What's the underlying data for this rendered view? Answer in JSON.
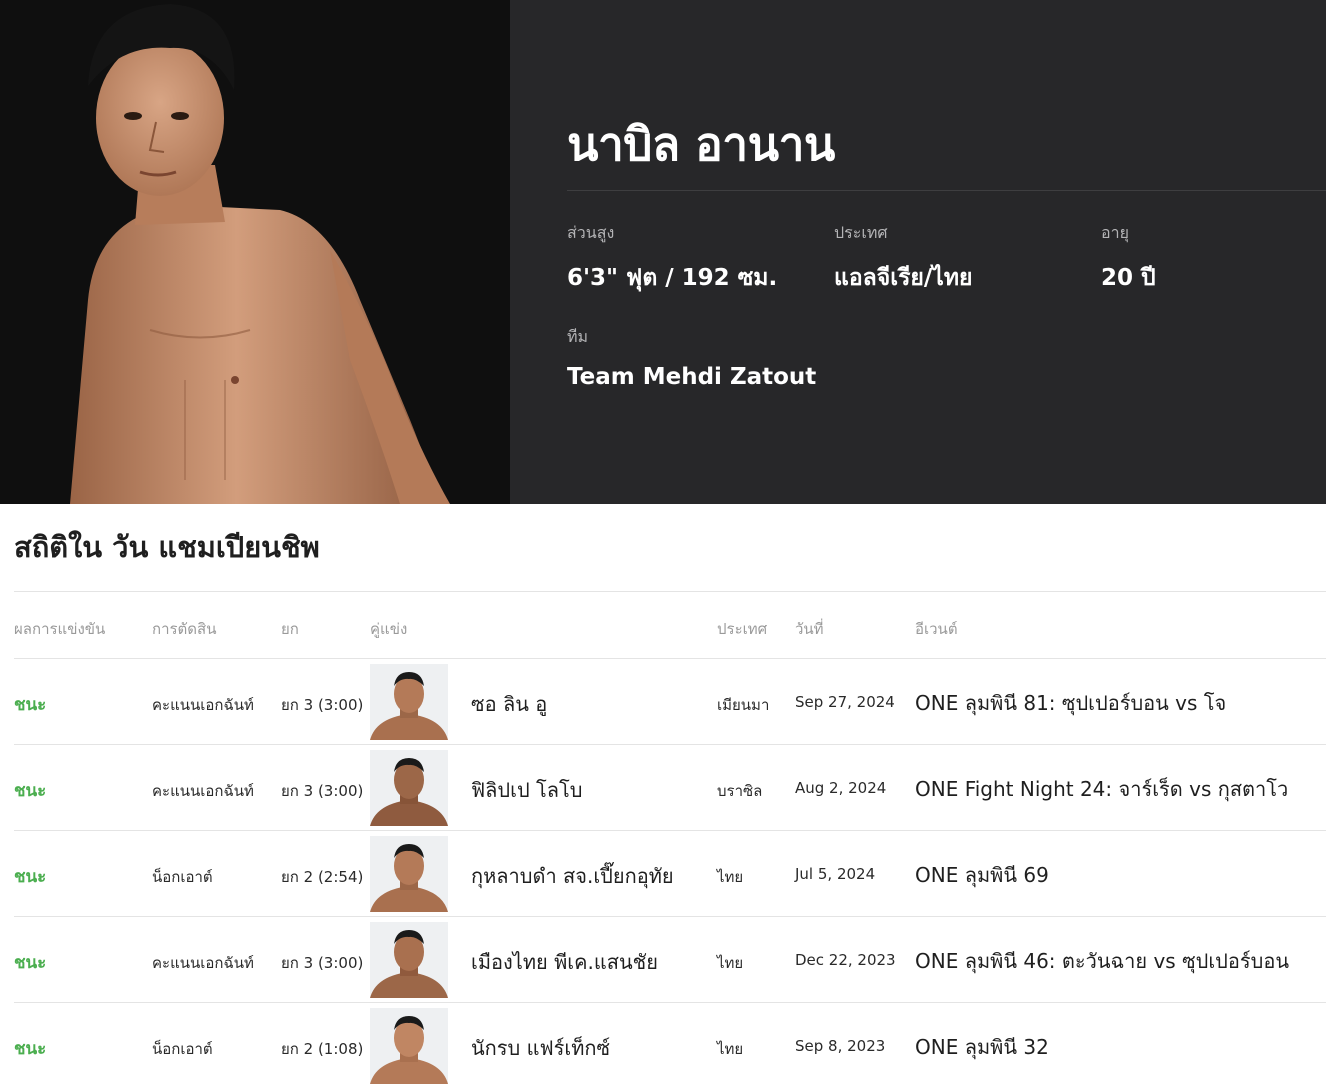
{
  "fighter": {
    "name": "นาบิล อานาน",
    "height_label": "ส่วนสูง",
    "height_value": "6'3\" ฟุต / 192 ซม.",
    "country_label": "ประเทศ",
    "country_value": "แอลจีเรีย/ไทย",
    "age_label": "อายุ",
    "age_value": "20 ปี",
    "team_label": "ทีม",
    "team_value": "Team Mehdi Zatout"
  },
  "stats": {
    "title": "สถิติใน วัน แชมเปียนชิพ",
    "headers": {
      "result": "ผลการแข่งขัน",
      "method": "การตัดสิน",
      "round": "ยก",
      "opponent": "คู่แข่ง",
      "country": "ประเทศ",
      "date": "วันที่",
      "event": "อีเวนต์"
    },
    "rows": [
      {
        "result": "ชนะ",
        "method": "คะแนนเอกฉันท์",
        "round": "ยก 3 (3:00)",
        "opponent": "ซอ ลิน อู",
        "country": "เมียนมา",
        "date": "Sep 27, 2024",
        "event": "ONE ลุมพินี 81: ซุปเปอร์บอน vs โจ"
      },
      {
        "result": "ชนะ",
        "method": "คะแนนเอกฉันท์",
        "round": "ยก 3 (3:00)",
        "opponent": "ฟิลิปเป โลโบ",
        "country": "บราซิล",
        "date": "Aug 2, 2024",
        "event": "ONE Fight Night 24: จาร์เร็ด vs กุสตาโว"
      },
      {
        "result": "ชนะ",
        "method": "น็อกเอาต์",
        "round": "ยก 2 (2:54)",
        "opponent": "กุหลาบดำ สจ.เปี๊ยกอุทัย",
        "country": "ไทย",
        "date": "Jul 5, 2024",
        "event": "ONE ลุมพินี 69"
      },
      {
        "result": "ชนะ",
        "method": "คะแนนเอกฉันท์",
        "round": "ยก 3 (3:00)",
        "opponent": "เมืองไทย พีเค.แสนชัย",
        "country": "ไทย",
        "date": "Dec 22, 2023",
        "event": "ONE ลุมพินี 46: ตะวันฉาย vs ซุปเปอร์บอน"
      },
      {
        "result": "ชนะ",
        "method": "น็อกเอาต์",
        "round": "ยก 2 (1:08)",
        "opponent": "นักรบ แฟร์เท็กซ์",
        "country": "ไทย",
        "date": "Sep 8, 2023",
        "event": "ONE ลุมพินี 32"
      }
    ]
  },
  "colors": {
    "hero_bg": "#272729",
    "photo_bg": "#0f0f0f",
    "win_green": "#4bae4f",
    "skin_tone": "#c89272"
  }
}
